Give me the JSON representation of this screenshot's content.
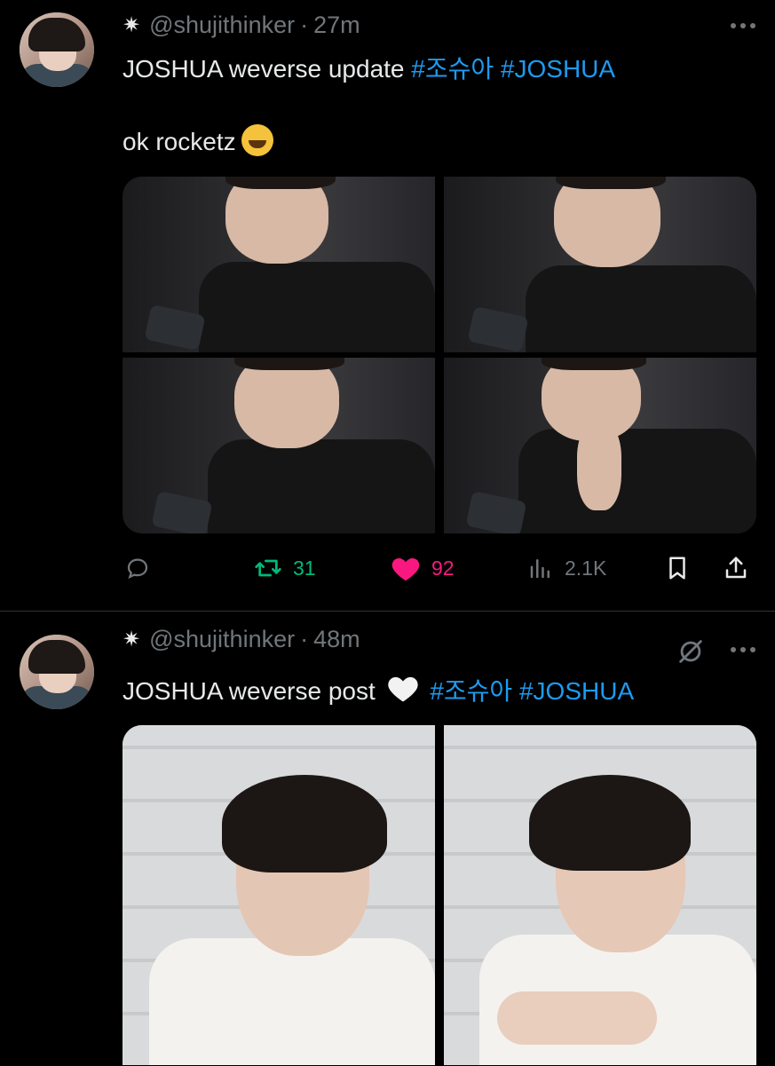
{
  "tweets": [
    {
      "handle": "@shujithinker",
      "separator": "·",
      "time": "27m",
      "text_main": "JOSHUA weverse update",
      "hashtag_1": "#조슈아",
      "hashtag_2": "#JOSHUA",
      "text_second": "ok rocketz",
      "emoji": "rolling-on-floor-laughing",
      "photos": [
        "photo-1",
        "photo-2",
        "photo-3",
        "photo-4"
      ],
      "actions": {
        "reply_icon": "reply-icon",
        "retweet_icon": "retweet-icon",
        "retweet_count": "31",
        "like_icon": "heart-icon",
        "like_count": "92",
        "views_icon": "views-icon",
        "views_count": "2.1K",
        "bookmark_icon": "bookmark-icon",
        "share_icon": "share-icon"
      }
    },
    {
      "handle": "@shujithinker",
      "separator": "·",
      "time": "48m",
      "text_main": "JOSHUA weverse post",
      "emoji": "white-heart",
      "hashtag_1": "#조슈아",
      "hashtag_2": "#JOSHUA",
      "photos": [
        "photo-1",
        "photo-2"
      ]
    }
  ],
  "colors": {
    "background": "#000000",
    "text": "#e7e9ea",
    "muted": "#71767b",
    "link": "#1d9bf0",
    "retweet": "#00ba7c",
    "like": "#f91880"
  }
}
